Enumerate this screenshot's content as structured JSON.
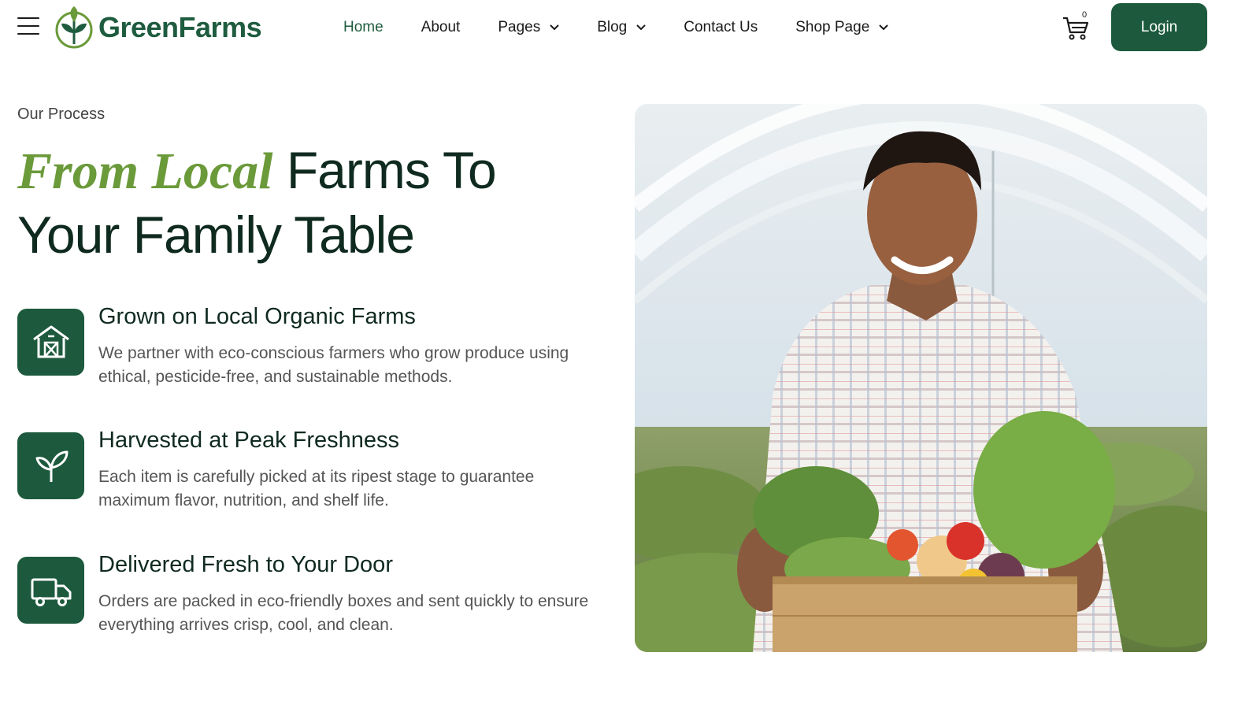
{
  "brand": {
    "name": "GreenFarms",
    "primary": "#1d5a3d",
    "accent": "#6b9a3a"
  },
  "header": {
    "menu_icon": "hamburger-menu-icon",
    "nav": [
      {
        "label": "Home",
        "active": true,
        "dropdown": false
      },
      {
        "label": "About",
        "active": false,
        "dropdown": false
      },
      {
        "label": "Pages",
        "active": false,
        "dropdown": true
      },
      {
        "label": "Blog",
        "active": false,
        "dropdown": true
      },
      {
        "label": "Contact Us",
        "active": false,
        "dropdown": false
      },
      {
        "label": "Shop Page",
        "active": false,
        "dropdown": true
      }
    ],
    "cart_count": "0",
    "login_label": "Login"
  },
  "hero": {
    "eyebrow": "Our Process",
    "headline_accent": "From Local",
    "headline_line1_rest": "Farms To",
    "headline_line2": "Your Family Table"
  },
  "features": [
    {
      "icon": "barn-icon",
      "title": "Grown on Local Organic Farms",
      "description": "We partner with eco-conscious farmers who grow produce using ethical, pesticide-free, and sustainable methods."
    },
    {
      "icon": "sprout-icon",
      "title": "Harvested at Peak Freshness",
      "description": "Each item is carefully picked at its ripest stage to guarantee maximum flavor, nutrition, and shelf life."
    },
    {
      "icon": "delivery-truck-icon",
      "title": "Delivered Fresh to Your Door",
      "description": "Orders are packed in eco-friendly boxes and sent quickly to ensure everything arrives crisp, cool, and clean."
    }
  ]
}
